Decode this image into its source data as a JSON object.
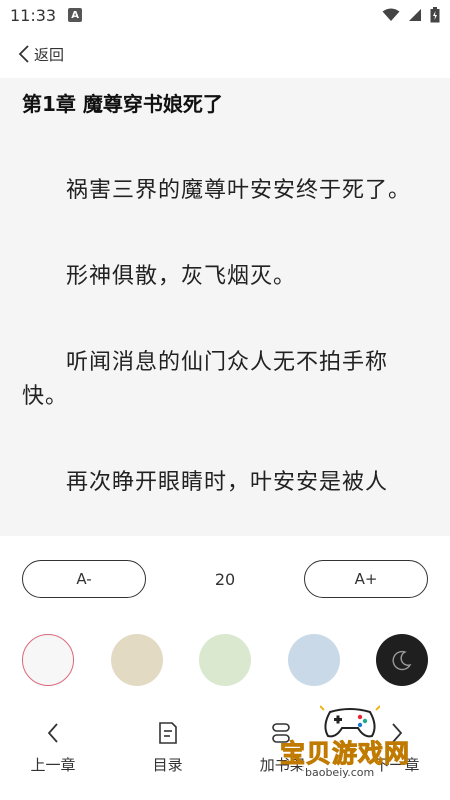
{
  "status_bar": {
    "time": "11:33",
    "notification_letter": "A"
  },
  "nav": {
    "back_label": "返回"
  },
  "chapter": {
    "title": "第1章 魔尊穿书娘死了",
    "paragraphs": [
      "祸害三界的魔尊叶安安终于死了。",
      "形神俱散，灰飞烟灭。",
      "听闻消息的仙门众人无不拍手称快。",
      "再次睁开眼睛时，叶安安是被人"
    ]
  },
  "font_controls": {
    "decrease_label": "A-",
    "size_value": "20",
    "increase_label": "A+"
  },
  "themes": [
    {
      "name": "white",
      "color": "#f7f7f7",
      "selected": true
    },
    {
      "name": "beige",
      "color": "#e2dac2",
      "selected": false
    },
    {
      "name": "green",
      "color": "#d9e8cf",
      "selected": false
    },
    {
      "name": "blue",
      "color": "#c9d9e8",
      "selected": false
    },
    {
      "name": "night",
      "color": "#1f1f1f",
      "selected": false,
      "icon": "moon-icon"
    }
  ],
  "bottom_bar": {
    "prev_label": "上一章",
    "toc_label": "目录",
    "bookshelf_label": "加书架",
    "next_label": "下一章"
  },
  "watermark": {
    "title": "宝贝游戏网",
    "url": "baobeiy.com"
  },
  "colors": {
    "accent_selected_ring": "#d86a7c",
    "watermark_gold": "#f0b514"
  }
}
